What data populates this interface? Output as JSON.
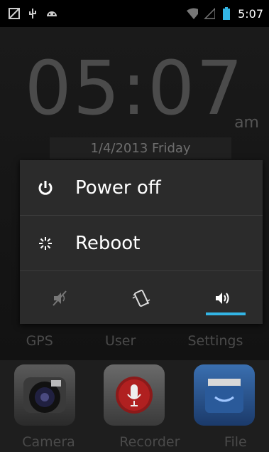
{
  "status_bar": {
    "time": "5:07",
    "icons": [
      "screenshot-icon",
      "usb-icon",
      "android-debug-icon",
      "wifi-icon",
      "signal-icon",
      "battery-icon"
    ]
  },
  "lockscreen": {
    "clock": "05:07",
    "ampm": "am",
    "date": "1/4/2013  Friday"
  },
  "power_menu": {
    "items": [
      {
        "label": "Power off",
        "icon": "power-icon"
      },
      {
        "label": "Reboot",
        "icon": "reboot-icon"
      }
    ],
    "sound_modes": [
      "silent-icon",
      "vibrate-icon",
      "sound-on-icon"
    ],
    "selected_mode": 2,
    "accent": "#33b5e5"
  },
  "background_shortcuts": [
    "GPS",
    "User",
    "Settings"
  ],
  "dock": {
    "apps": [
      {
        "label": "Camera",
        "icon": "camera-icon"
      },
      {
        "label": "Recorder",
        "icon": "microphone-icon"
      },
      {
        "label": "File",
        "icon": "file-box-icon"
      }
    ]
  }
}
